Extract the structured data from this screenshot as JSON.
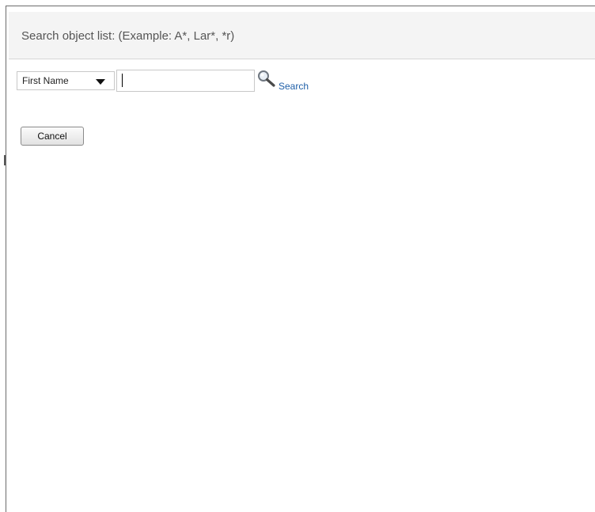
{
  "header": {
    "title": "Search object list: (Example: A*, Lar*, *r)"
  },
  "search": {
    "field_select_value": "First Name",
    "input_value": "",
    "search_link_label": "Search"
  },
  "actions": {
    "cancel_label": "Cancel"
  },
  "icons": {
    "search": "magnifier-icon",
    "dropdown": "caret-down-icon"
  },
  "colors": {
    "link": "#1f5fa8",
    "header_bg": "#f4f4f4"
  }
}
